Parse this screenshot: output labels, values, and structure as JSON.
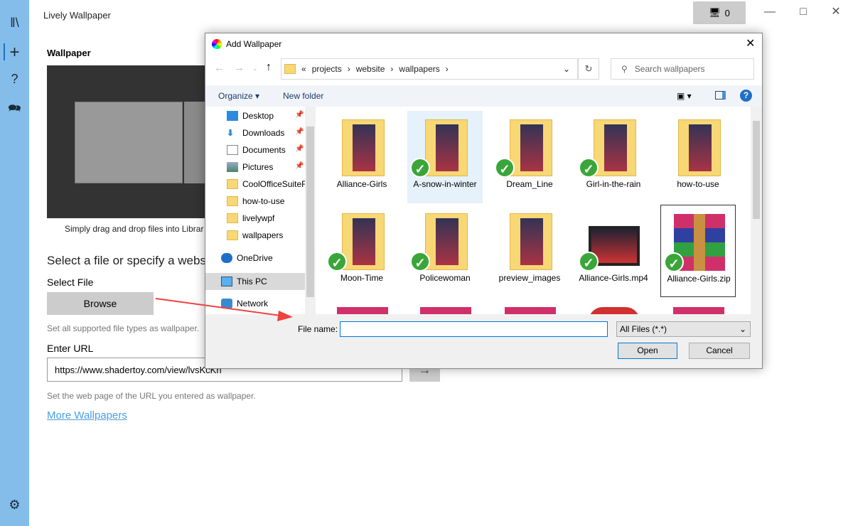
{
  "app": {
    "title": "Lively Wallpaper",
    "screen_count": "0"
  },
  "rail": {
    "icons": [
      "library-icon",
      "add-icon",
      "help-icon",
      "feedback-icon",
      "settings-icon"
    ]
  },
  "main": {
    "section_title": "Wallpaper",
    "drag_text": "Simply drag and drop files into Librar",
    "select_heading": "Select a file or specify a websi",
    "select_file_label": "Select File",
    "browse_label": "Browse",
    "file_hint": "Set all supported file types as wallpaper.",
    "url_label": "Enter URL",
    "url_value": "https://www.shadertoy.com/view/lvsKcKh",
    "url_hint": "Set the web page of the URL you entered as wallpaper.",
    "more_link": "More Wallpapers"
  },
  "dialog": {
    "title": "Add Wallpaper",
    "breadcrumb": [
      "projects",
      "website",
      "wallpapers"
    ],
    "search_placeholder": "Search wallpapers",
    "organize": "Organize",
    "new_folder": "New folder",
    "nav": [
      {
        "label": "Desktop",
        "pinned": true
      },
      {
        "label": "Downloads",
        "pinned": true
      },
      {
        "label": "Documents",
        "pinned": true
      },
      {
        "label": "Pictures",
        "pinned": true
      },
      {
        "label": "CoolOfficeSuiteF",
        "pinned": false
      },
      {
        "label": "how-to-use",
        "pinned": false
      },
      {
        "label": "livelywpf",
        "pinned": false
      },
      {
        "label": "wallpapers",
        "pinned": false
      },
      {
        "label": "OneDrive",
        "pinned": false
      },
      {
        "label": "This PC",
        "pinned": false,
        "selected": true
      },
      {
        "label": "Network",
        "pinned": false
      }
    ],
    "files": [
      {
        "name": "Alliance-Girls",
        "type": "folder",
        "check": false
      },
      {
        "name": "A-snow-in-winter",
        "type": "folder",
        "check": true,
        "selected": true
      },
      {
        "name": "Dream_Line",
        "type": "folder",
        "check": true
      },
      {
        "name": "Girl-in-the-rain",
        "type": "folder",
        "check": true
      },
      {
        "name": "how-to-use",
        "type": "folder",
        "check": false
      },
      {
        "name": "Moon-Time",
        "type": "folder",
        "check": true
      },
      {
        "name": "Policewoman",
        "type": "folder",
        "check": true
      },
      {
        "name": "preview_images",
        "type": "folder",
        "check": false
      },
      {
        "name": "Alliance-Girls.mp4",
        "type": "video",
        "check": true
      },
      {
        "name": "Alliance-Girls.zip",
        "type": "archive",
        "check": true,
        "focused": true
      }
    ],
    "file_name_label": "File name:",
    "file_name_value": "",
    "filter": "All Files (*.*)",
    "open": "Open",
    "cancel": "Cancel"
  },
  "colors": {
    "rail": "#84bdea",
    "link": "#4a9fe0",
    "arrow": "#f04040"
  }
}
